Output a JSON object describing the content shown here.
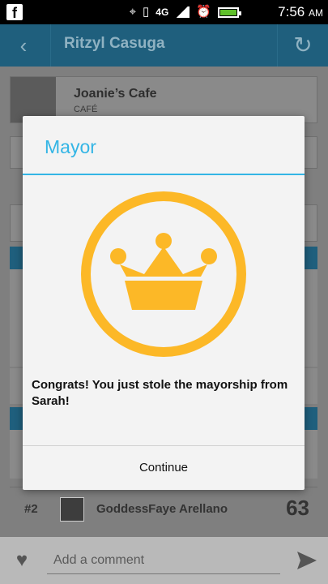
{
  "status_bar": {
    "app_icon": "facebook-icon",
    "network": "4G",
    "time": "7:56",
    "ampm": "AM"
  },
  "header": {
    "title": "Ritzyl Casuga",
    "back_icon": "back-chevron-icon",
    "refresh_icon": "refresh-icon"
  },
  "venue": {
    "name": "Joanie’s Cafe",
    "category": "CAFÉ"
  },
  "dialog": {
    "title": "Mayor",
    "message": "Congrats! You just stole the mayorship from Sarah!",
    "button": "Continue",
    "badge_icon": "crown-icon",
    "accent_color": "#33b5e5",
    "badge_color": "#fcb827"
  },
  "leaderboard_row": {
    "rank": "#2",
    "name": "GoddessFaye  Arellano",
    "score": "63"
  },
  "comment_bar": {
    "placeholder": "Add a comment",
    "like_icon": "heart-icon",
    "send_icon": "send-icon"
  }
}
